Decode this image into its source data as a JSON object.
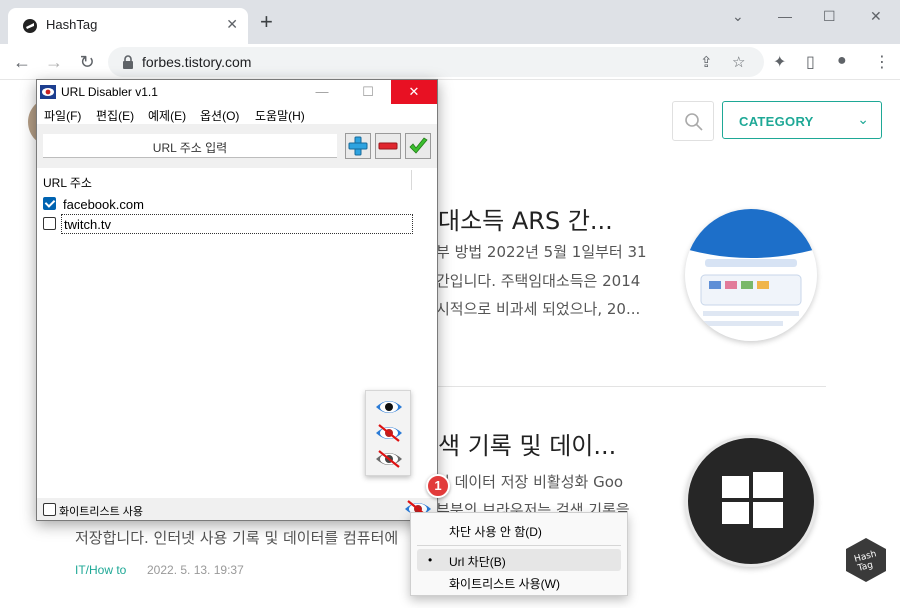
{
  "browser": {
    "tab_title": "HashTag",
    "tab_close": "✕",
    "new_tab": "+",
    "url": "forbes.tistory.com",
    "window_controls": {
      "minimize": "⌄",
      "min": "—",
      "max": "☐",
      "close": "✕"
    },
    "nav": {
      "back": "←",
      "forward": "→",
      "reload": "↻"
    },
    "icons": {
      "share": "⇪",
      "star": "☆",
      "extensions": "✦",
      "sidepanel": "▯",
      "profile": "●",
      "menu": "⋮"
    }
  },
  "blog": {
    "category_label": "CATEGORY",
    "category_chevron": "⌄",
    "articles": [
      {
        "title": "대소득 ARS 간...",
        "lines": [
          "부 방법 2022년 5월 1일부터 31",
          "간입니다. 주택임대소득은 2014",
          "시적으로 비과세 되었으나, 20..."
        ]
      },
      {
        "title": "색 기록 및 데이...",
        "lines": [
          "및 데이터 저장 비활성화 Goo",
          "부분의 브라우저는 검색 기록을",
          "저장합니다. 인터넷 사용 기록 및 데이터를 컴퓨터에"
        ]
      }
    ],
    "meta_category": "IT/How to",
    "meta_date": "2022. 5. 13. 19:37",
    "badge_text": "Hash Tag"
  },
  "app": {
    "title": "URL Disabler v1.1",
    "menu": [
      "파일(F)",
      "편집(E)",
      "예제(E)",
      "옵션(O)",
      "도움말(H)"
    ],
    "url_placeholder": "URL 주소 입력",
    "column_header": "URL 주소",
    "entries": [
      {
        "url": "facebook.com",
        "checked": true
      },
      {
        "url": "twitch.tv",
        "checked": false
      }
    ],
    "whitelist_label": "화이트리스트 사용",
    "win_buttons": {
      "min": "—",
      "max": "☐",
      "close": "✕"
    }
  },
  "tray": {
    "badge": "1",
    "menu": {
      "disable": "차단 사용 안 함(D)",
      "url_block": "Url 차단(B)",
      "whitelist": "화이트리스트 사용(W)",
      "bullet": "•"
    }
  },
  "colors": {
    "accent": "#1ea896",
    "close_red": "#e81123",
    "checkbox_blue": "#0063b1"
  }
}
